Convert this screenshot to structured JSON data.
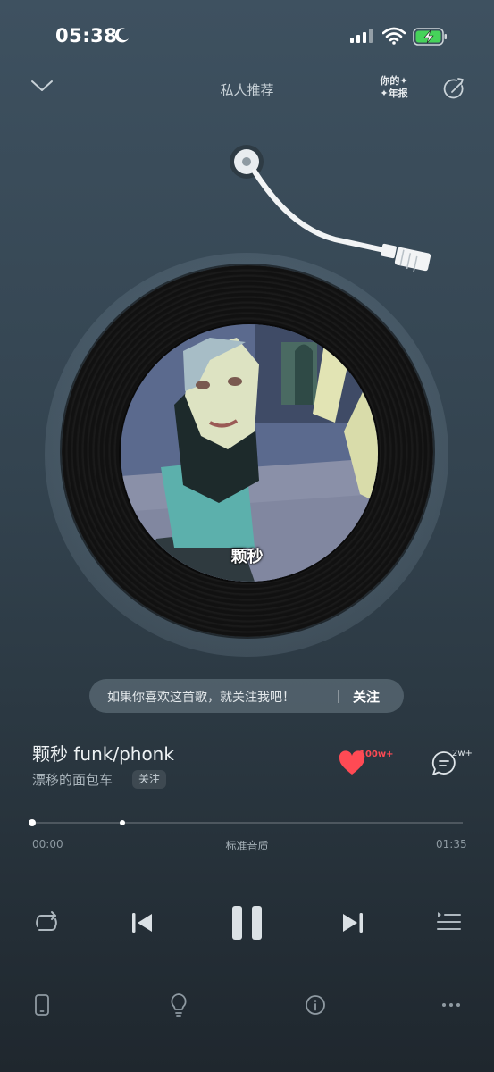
{
  "status_bar": {
    "time": "05:38"
  },
  "header": {
    "title": "私人推荐",
    "annual_line1": "你的✦",
    "annual_line2": "✦年报"
  },
  "record": {
    "cover_label": "颗秒"
  },
  "banner": {
    "text": "如果你喜欢这首歌，就关注我吧！",
    "button": "关注"
  },
  "song": {
    "title": "颗秒 funk/phonk",
    "artist": "漂移的面包车",
    "artist_follow": "关注",
    "like_count": "100w+",
    "comment_count": "2w+"
  },
  "progress": {
    "current": "00:00",
    "total": "01:35",
    "quality": "标准音质",
    "played_fraction": 0.0,
    "buffered_fraction": 0.21
  },
  "icons": {
    "repeat": "repeat-icon",
    "previous": "previous-icon",
    "pause": "pause-icon",
    "next": "next-icon",
    "playlist": "playlist-icon",
    "device": "phone-device-icon",
    "tip": "lightbulb-icon",
    "info": "info-icon",
    "more": "more-icon"
  },
  "colors": {
    "like": "#ff4a54",
    "accent": "#ffffff"
  }
}
